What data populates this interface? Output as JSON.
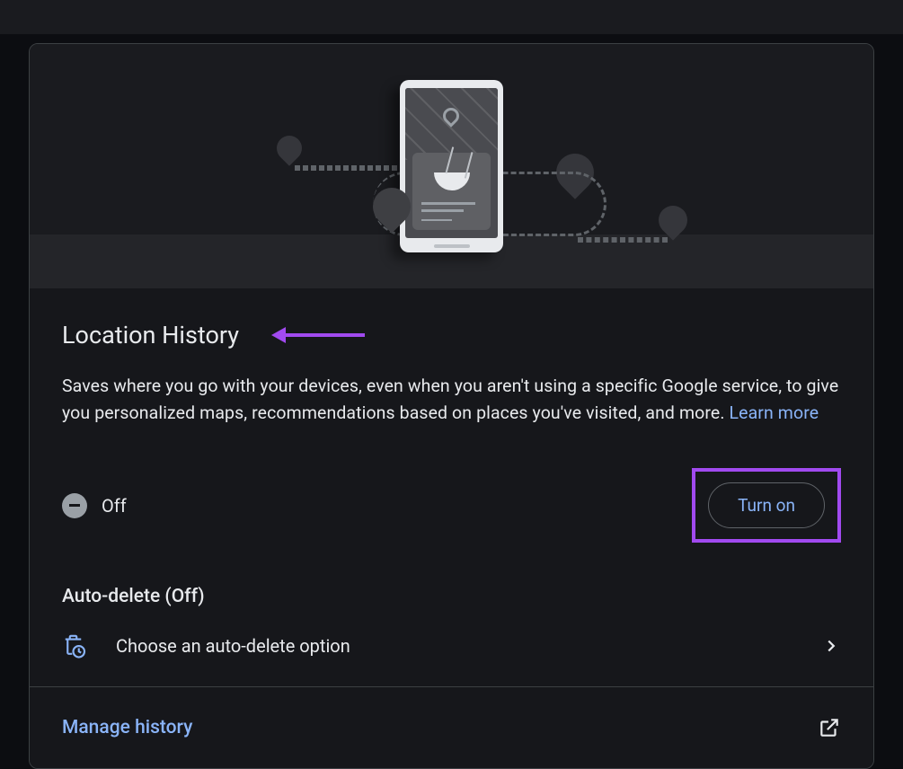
{
  "section": {
    "title": "Location History",
    "description": "Saves where you go with your devices, even when you aren't using a specific Google service, to give you personalized maps, recommendations based on places you've visited, and more. ",
    "learn_more": "Learn more",
    "status_label": "Off",
    "turn_on_label": "Turn on",
    "auto_delete_heading": "Auto-delete (Off)",
    "auto_delete_option": "Choose an auto-delete option",
    "manage_history": "Manage history"
  },
  "colors": {
    "accent": "#8ab4f8",
    "annotation": "#a14af0"
  }
}
